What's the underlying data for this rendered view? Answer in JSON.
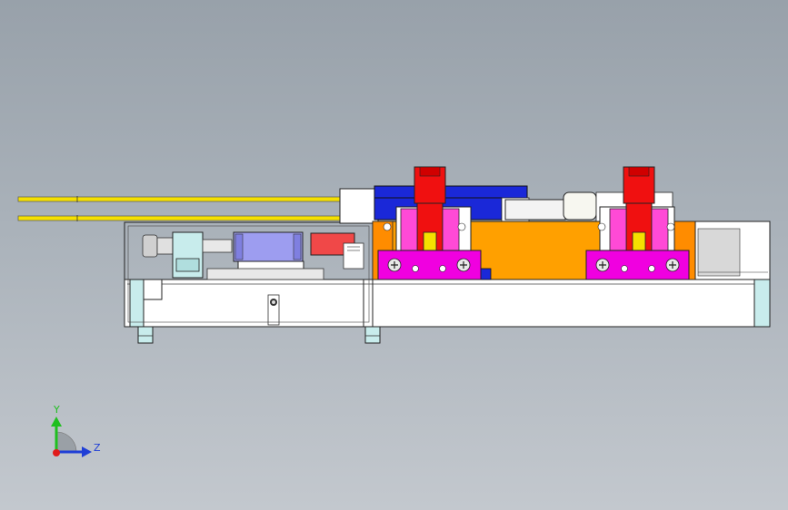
{
  "view": {
    "background_top": "#98a1aa",
    "background_bottom": "#c3c8ce"
  },
  "triad": {
    "y_label": "Y",
    "z_label": "Z",
    "y_color": "#1fbf1f",
    "z_color": "#1f3fd6",
    "x_color": "#e01b1b"
  },
  "colors": {
    "rod": "#f5e000",
    "clamp_red": "#f01010",
    "bracket_magenta": "#f000e0",
    "carriage_orange": "#ffa000",
    "rail_blue": "#1a28d8",
    "cylinder_violet": "#9d9df0",
    "base_white": "#ffffff",
    "fitting_cyan": "#c8ecec",
    "block_grey": "#d8d8d8"
  }
}
